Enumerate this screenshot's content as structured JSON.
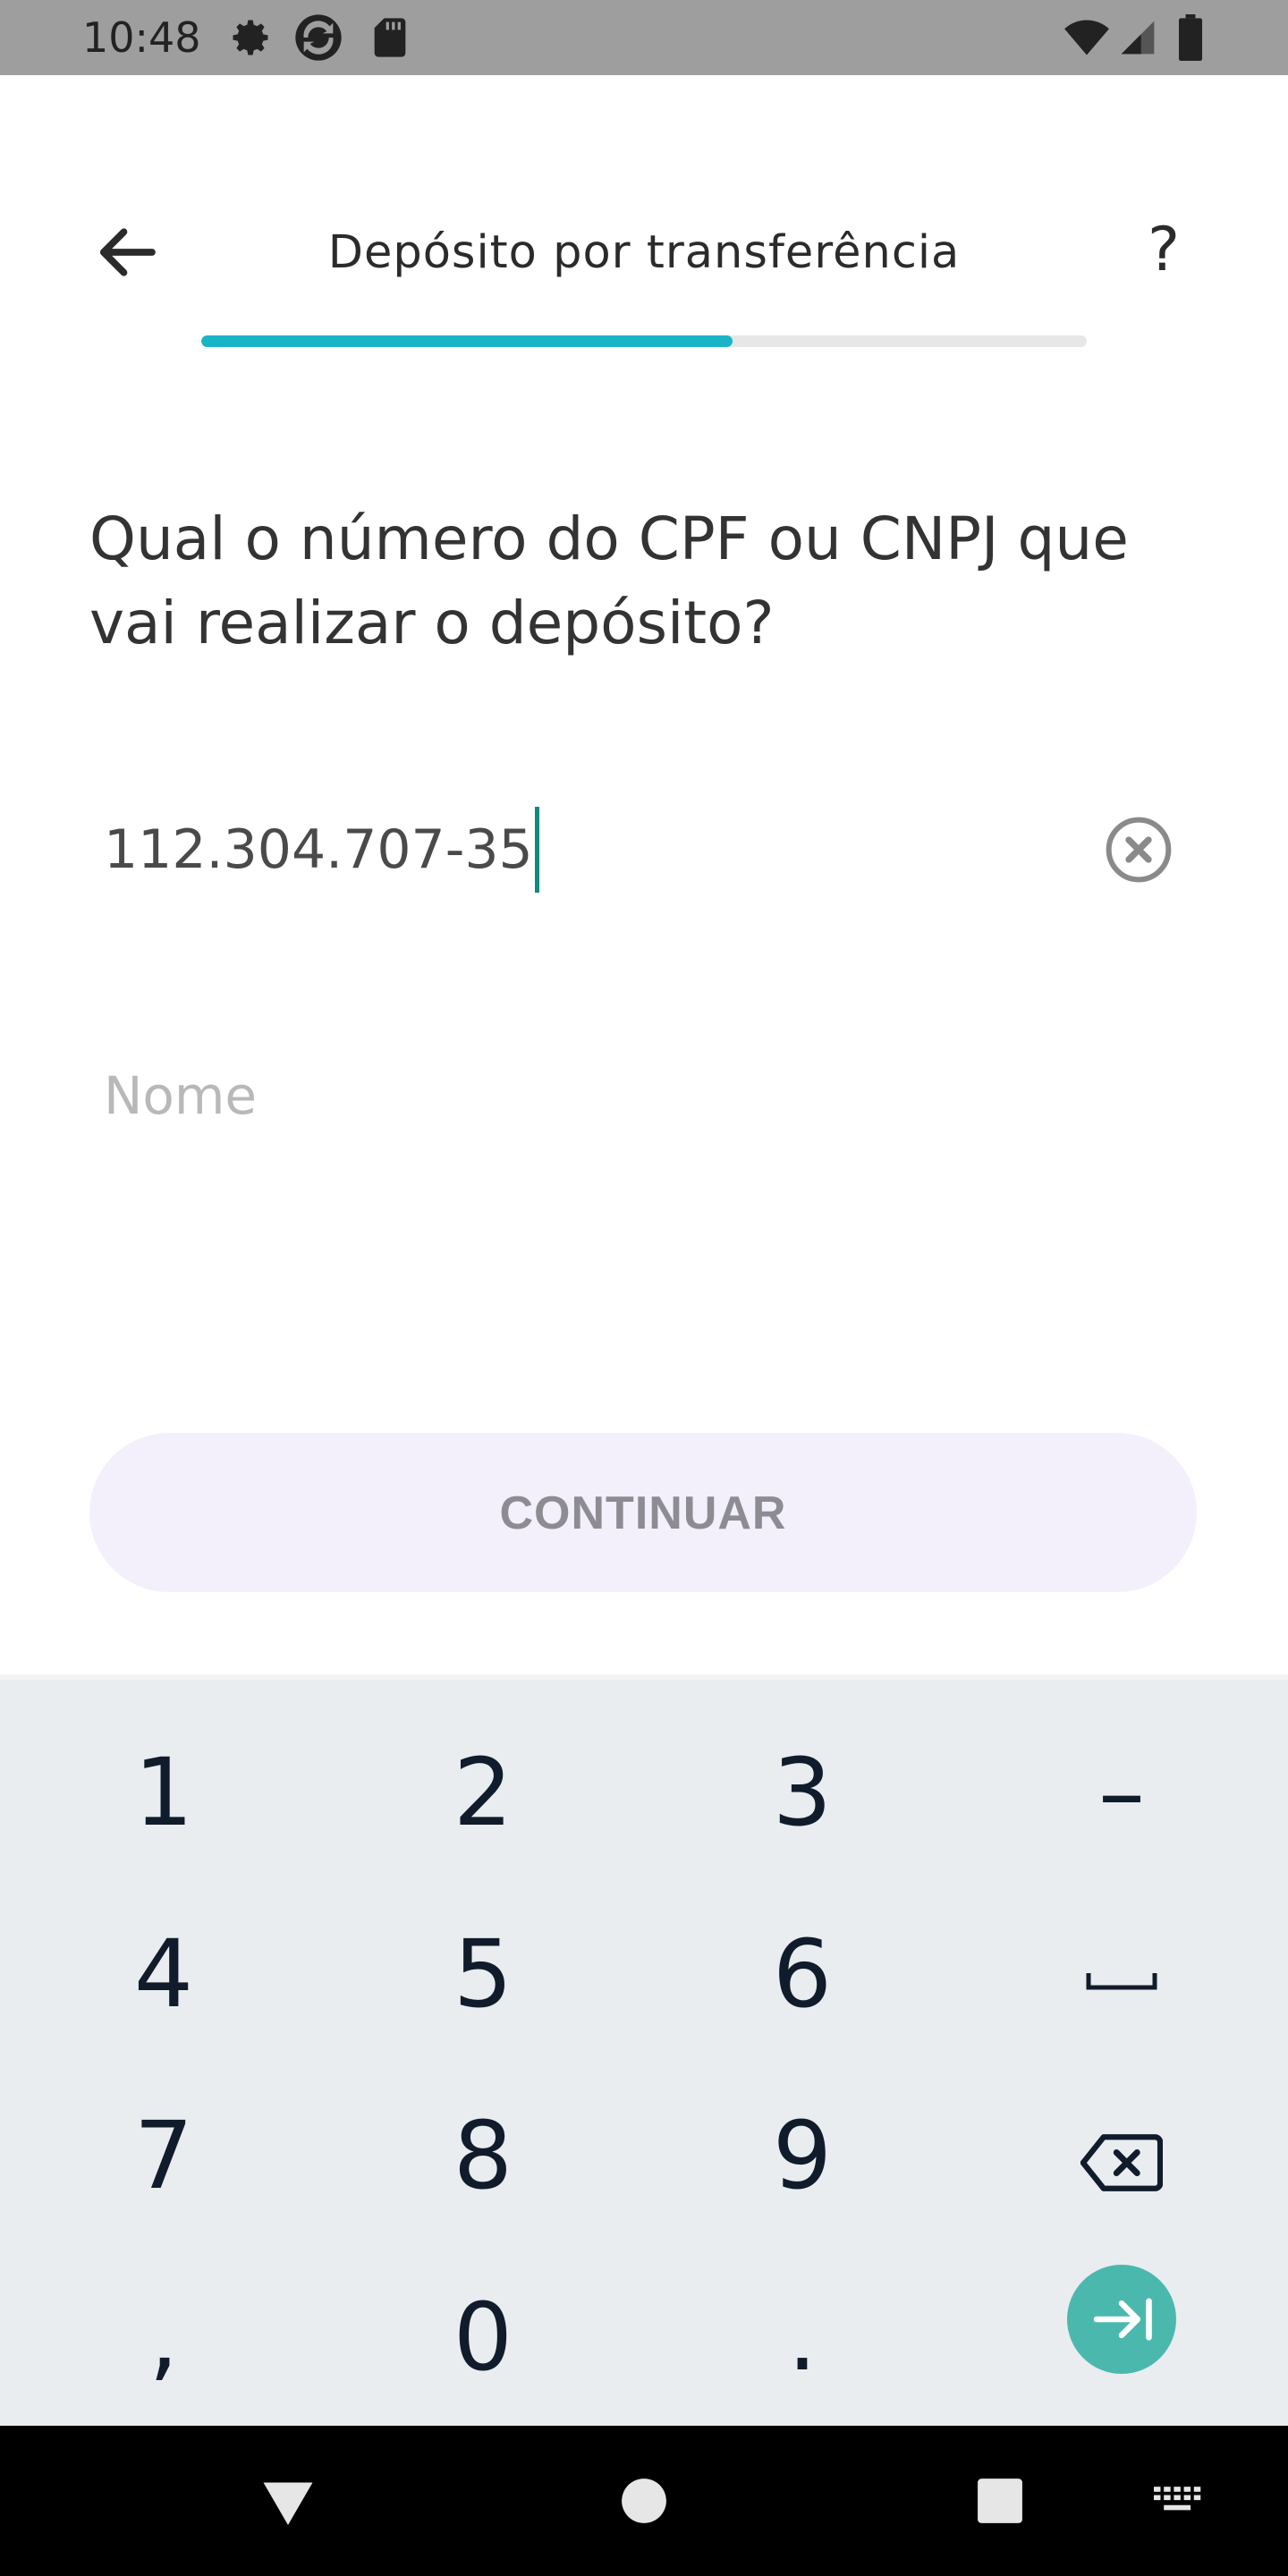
{
  "status_bar": {
    "time": "10:48",
    "left_icons": [
      "gear-icon",
      "sync-icon",
      "sd-card-icon"
    ],
    "right_icons": [
      "wifi-icon",
      "signal-icon",
      "battery-icon"
    ]
  },
  "header": {
    "title": "Depósito por transferência",
    "back_icon": "arrow-left-icon",
    "help_label": "?",
    "progress_fraction": 0.6
  },
  "question": "Qual o número do CPF ou CNPJ que vai realizar o depósito?",
  "document_field": {
    "value": "112.304.707-35",
    "clear_icon": "clear-circle-icon"
  },
  "name_field": {
    "value": "",
    "placeholder": "Nome"
  },
  "continue_button": {
    "label": "CONTINUAR"
  },
  "keyboard": {
    "keys": [
      "1",
      "2",
      "3",
      "–",
      "4",
      "5",
      "6",
      "space",
      "7",
      "8",
      "9",
      "backspace",
      ",",
      "0",
      ".",
      "next"
    ],
    "labels": {
      "k1": "1",
      "k2": "2",
      "k3": "3",
      "dash": "–",
      "k4": "4",
      "k5": "5",
      "k6": "6",
      "k7": "7",
      "k8": "8",
      "k9": "9",
      "comma": ",",
      "k0": "0",
      "period": "."
    },
    "enter_color": "#4bb8ae"
  },
  "nav_bar": {
    "icons": [
      "back-triangle-icon",
      "home-circle-icon",
      "recents-square-icon",
      "keyboard-icon"
    ]
  },
  "colors": {
    "accent": "#19b5c6",
    "caret": "#0e8a80",
    "button_bg": "#f3f0fc",
    "button_text": "#8d8c93"
  }
}
